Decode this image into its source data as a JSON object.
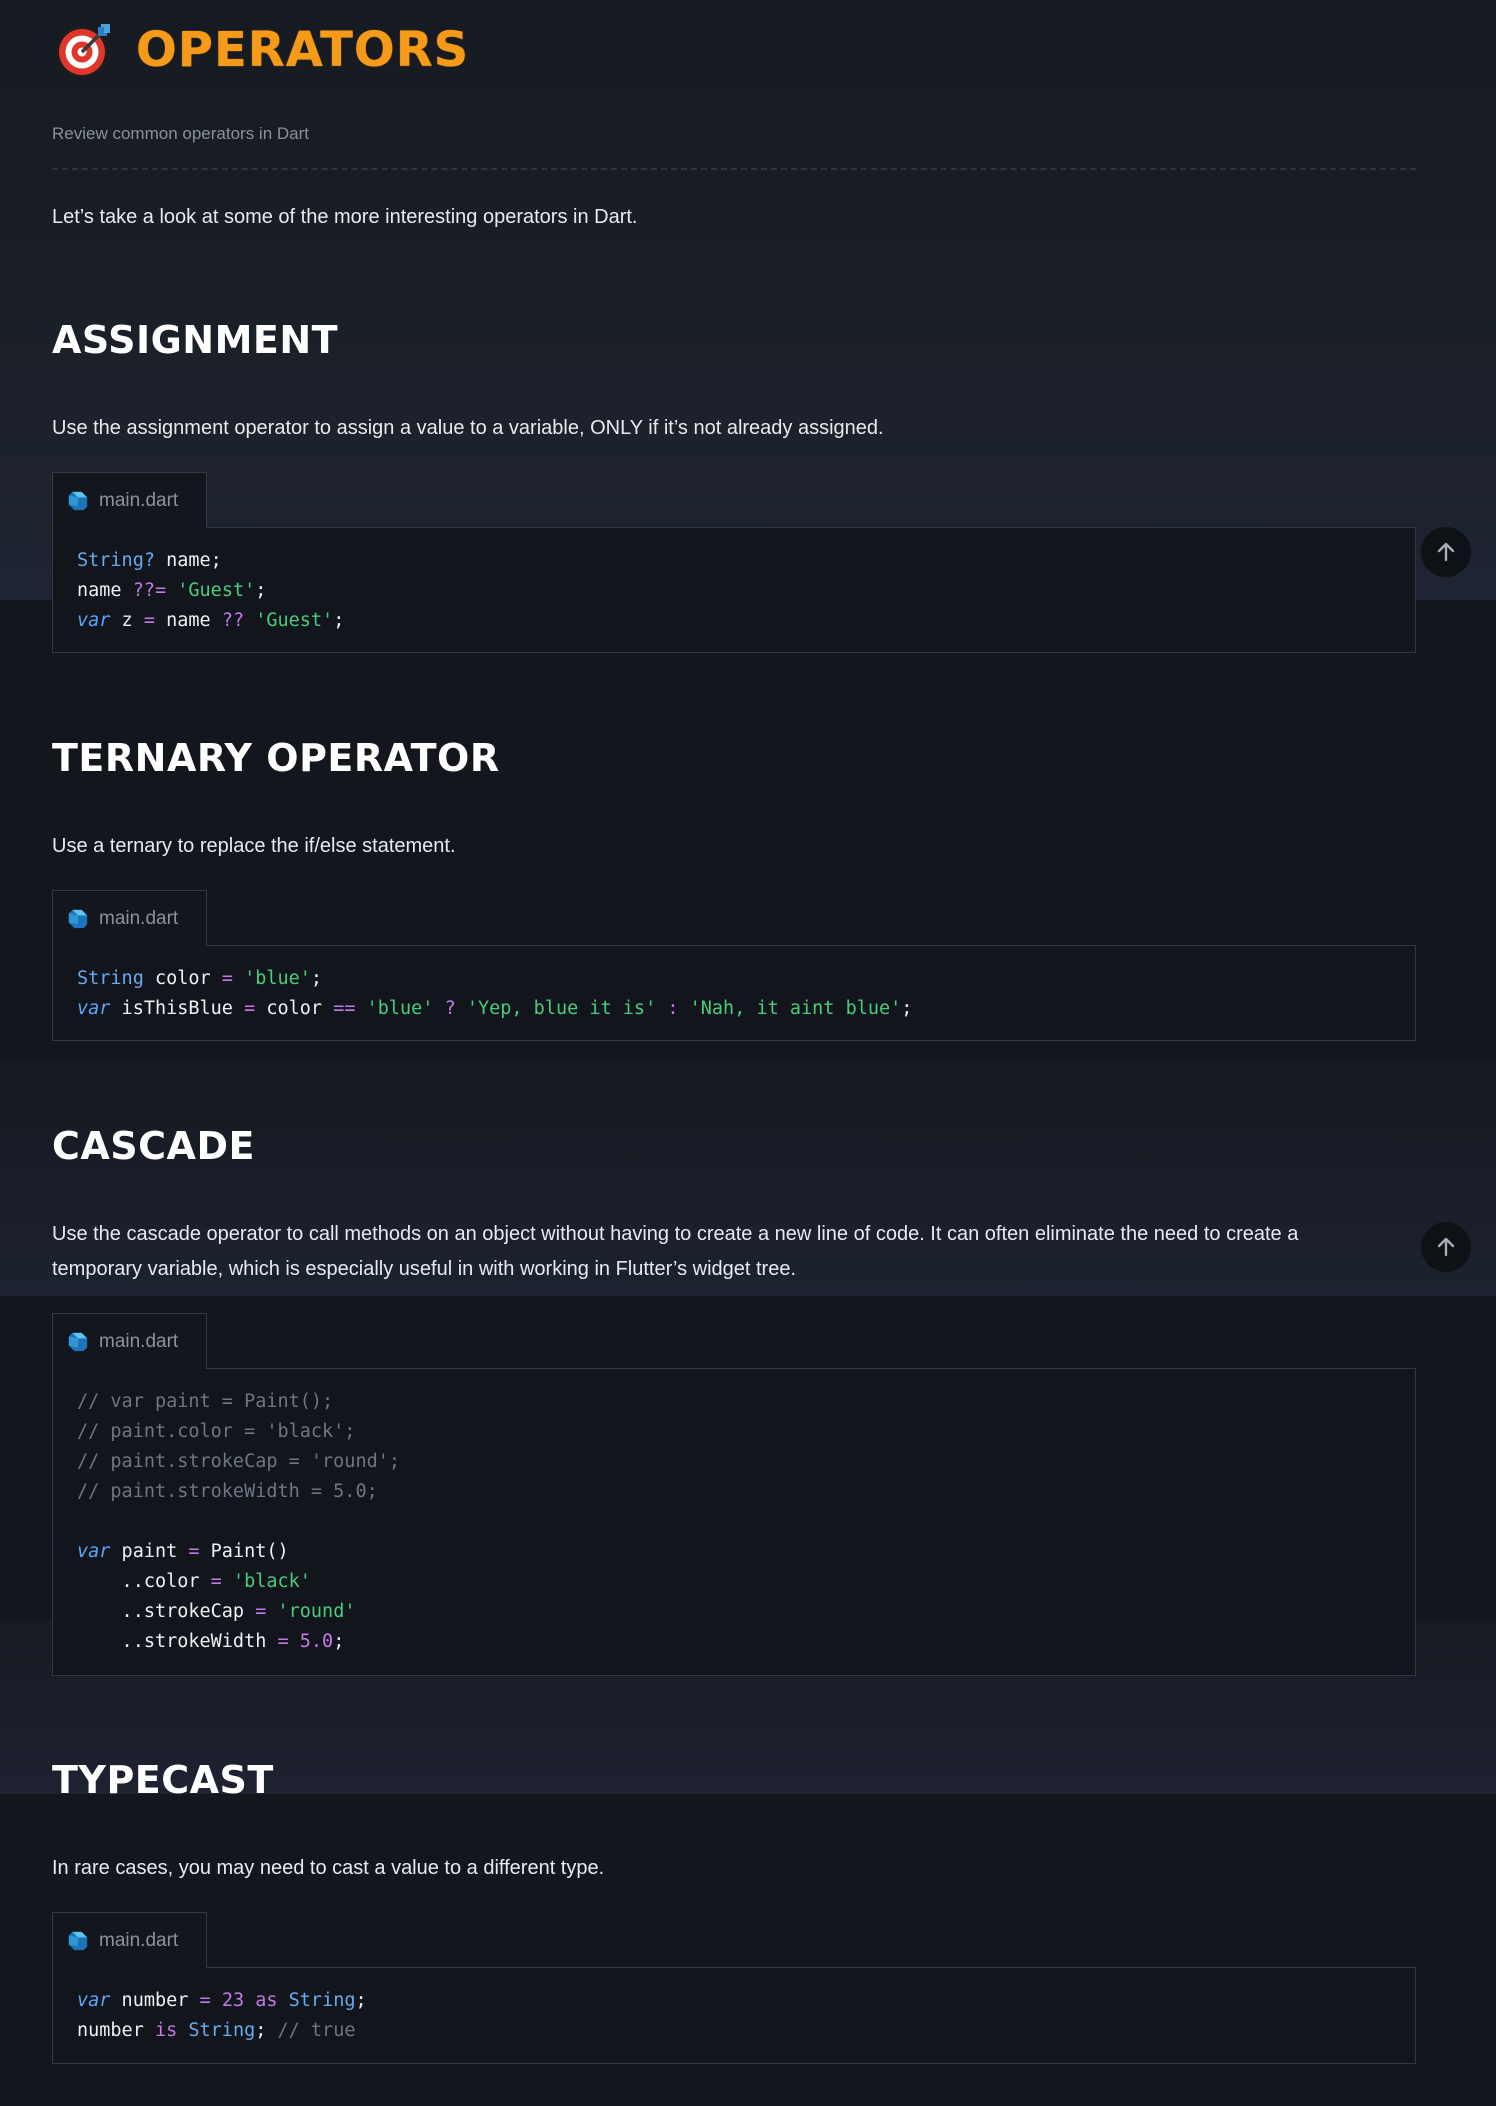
{
  "header": {
    "title": "OPERATORS",
    "subtitle": "Review common operators in Dart",
    "intro": "Let’s take a look at some of the more interesting operators in Dart."
  },
  "icons": {
    "title_icon": "target-dart-icon",
    "file_icon": "dart-logo-icon",
    "scroll_icon": "arrow-up-icon"
  },
  "colors": {
    "title": "#f59a19",
    "keyword": "#5aa6ff",
    "type": "#69a9ee",
    "operator": "#c679e8",
    "string": "#49cc7c",
    "comment": "#6e7683"
  },
  "sections": [
    {
      "heading": "ASSIGNMENT",
      "text": "Use the assignment operator to assign a value to a variable, ONLY if it’s not already assigned.",
      "file": "main.dart",
      "code": [
        [
          [
            "String?",
            "type"
          ],
          [
            " name;",
            "plain"
          ]
        ],
        [
          [
            "name ",
            "plain"
          ],
          [
            "??=",
            "op"
          ],
          [
            " ",
            "plain"
          ],
          [
            "'Guest'",
            "str"
          ],
          [
            ";",
            "plain"
          ]
        ],
        [
          [
            "var",
            "kw"
          ],
          [
            " z ",
            "plain"
          ],
          [
            "=",
            "op"
          ],
          [
            " name ",
            "plain"
          ],
          [
            "??",
            "op"
          ],
          [
            " ",
            "plain"
          ],
          [
            "'Guest'",
            "str"
          ],
          [
            ";",
            "plain"
          ]
        ]
      ]
    },
    {
      "heading": "TERNARY OPERATOR",
      "text": "Use a ternary to replace the if/else statement.",
      "file": "main.dart",
      "code": [
        [
          [
            "String",
            "type"
          ],
          [
            " color ",
            "plain"
          ],
          [
            "=",
            "op"
          ],
          [
            " ",
            "plain"
          ],
          [
            "'blue'",
            "str"
          ],
          [
            ";",
            "plain"
          ]
        ],
        [
          [
            "var",
            "kw"
          ],
          [
            " isThisBlue ",
            "plain"
          ],
          [
            "=",
            "op"
          ],
          [
            " color ",
            "plain"
          ],
          [
            "==",
            "op"
          ],
          [
            " ",
            "plain"
          ],
          [
            "'blue'",
            "str"
          ],
          [
            " ",
            "plain"
          ],
          [
            "?",
            "op"
          ],
          [
            " ",
            "plain"
          ],
          [
            "'Yep, blue it is'",
            "str"
          ],
          [
            " ",
            "plain"
          ],
          [
            ":",
            "op"
          ],
          [
            " ",
            "plain"
          ],
          [
            "'Nah, it aint blue'",
            "str"
          ],
          [
            ";",
            "plain"
          ]
        ]
      ]
    },
    {
      "heading": "CASCADE",
      "text": "Use the cascade operator to call methods on an object without having to create a new line of code. It can often eliminate the need to create a temporary variable, which is especially useful in with working in Flutter’s widget tree.",
      "file": "main.dart",
      "code": [
        [
          [
            "// var paint = Paint();",
            "com"
          ]
        ],
        [
          [
            "// paint.color = 'black';",
            "com"
          ]
        ],
        [
          [
            "// paint.strokeCap = 'round';",
            "com"
          ]
        ],
        [
          [
            "// paint.strokeWidth = 5.0;",
            "com"
          ]
        ],
        [
          [
            "",
            "plain"
          ]
        ],
        [
          [
            "var",
            "kw"
          ],
          [
            " paint ",
            "plain"
          ],
          [
            "=",
            "op"
          ],
          [
            " Paint()",
            "plain"
          ]
        ],
        [
          [
            "    ..color ",
            "plain"
          ],
          [
            "=",
            "op"
          ],
          [
            " ",
            "plain"
          ],
          [
            "'black'",
            "str"
          ]
        ],
        [
          [
            "    ..strokeCap ",
            "plain"
          ],
          [
            "=",
            "op"
          ],
          [
            " ",
            "plain"
          ],
          [
            "'round'",
            "str"
          ]
        ],
        [
          [
            "    ..strokeWidth ",
            "plain"
          ],
          [
            "=",
            "op"
          ],
          [
            " ",
            "plain"
          ],
          [
            "5.0",
            "num"
          ],
          [
            ";",
            "plain"
          ]
        ]
      ]
    },
    {
      "heading": "TYPECAST",
      "text": "In rare cases, you may need to cast a value to a different type.",
      "file": "main.dart",
      "code": [
        [
          [
            "var",
            "kw"
          ],
          [
            " number ",
            "plain"
          ],
          [
            "=",
            "op"
          ],
          [
            " ",
            "plain"
          ],
          [
            "23",
            "num"
          ],
          [
            " ",
            "plain"
          ],
          [
            "as",
            "op"
          ],
          [
            " ",
            "plain"
          ],
          [
            "String",
            "type"
          ],
          [
            ";",
            "plain"
          ]
        ],
        [
          [
            "number ",
            "plain"
          ],
          [
            "is",
            "op"
          ],
          [
            " ",
            "plain"
          ],
          [
            "String",
            "type"
          ],
          [
            "; ",
            "plain"
          ],
          [
            "// true",
            "com"
          ]
        ]
      ]
    }
  ]
}
